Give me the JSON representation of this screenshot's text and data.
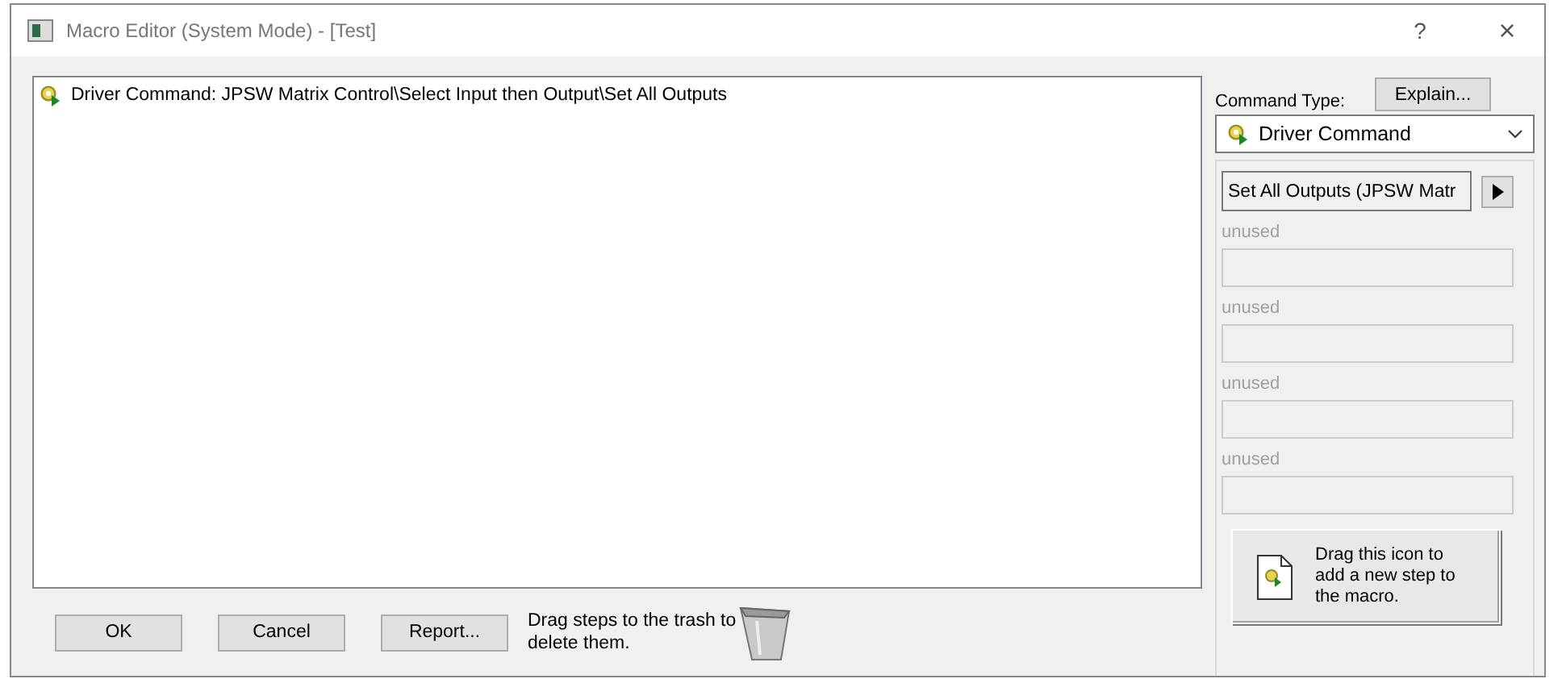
{
  "window": {
    "title": "Macro Editor (System Mode) - [Test]",
    "help": "?",
    "close": "×"
  },
  "steps": [
    {
      "text": "Driver Command: JPSW Matrix Control\\Select Input then Output\\Set All Outputs",
      "selected": false
    }
  ],
  "command_type": {
    "label": "Command Type:",
    "explain": "Explain...",
    "value": "Driver Command",
    "command": "Set All Outputs (JPSW Matr"
  },
  "parameters": [
    {
      "label": "unused",
      "disabled": true
    },
    {
      "label": "unused",
      "disabled": true
    },
    {
      "label": "unused",
      "disabled": true
    },
    {
      "label": "unused",
      "disabled": true
    }
  ],
  "new_step": {
    "text": "Drag this icon to add a new step to the macro."
  },
  "buttons": [
    "OK",
    "Cancel",
    "Report..."
  ],
  "trash_hint": "Drag steps to the trash to delete them."
}
